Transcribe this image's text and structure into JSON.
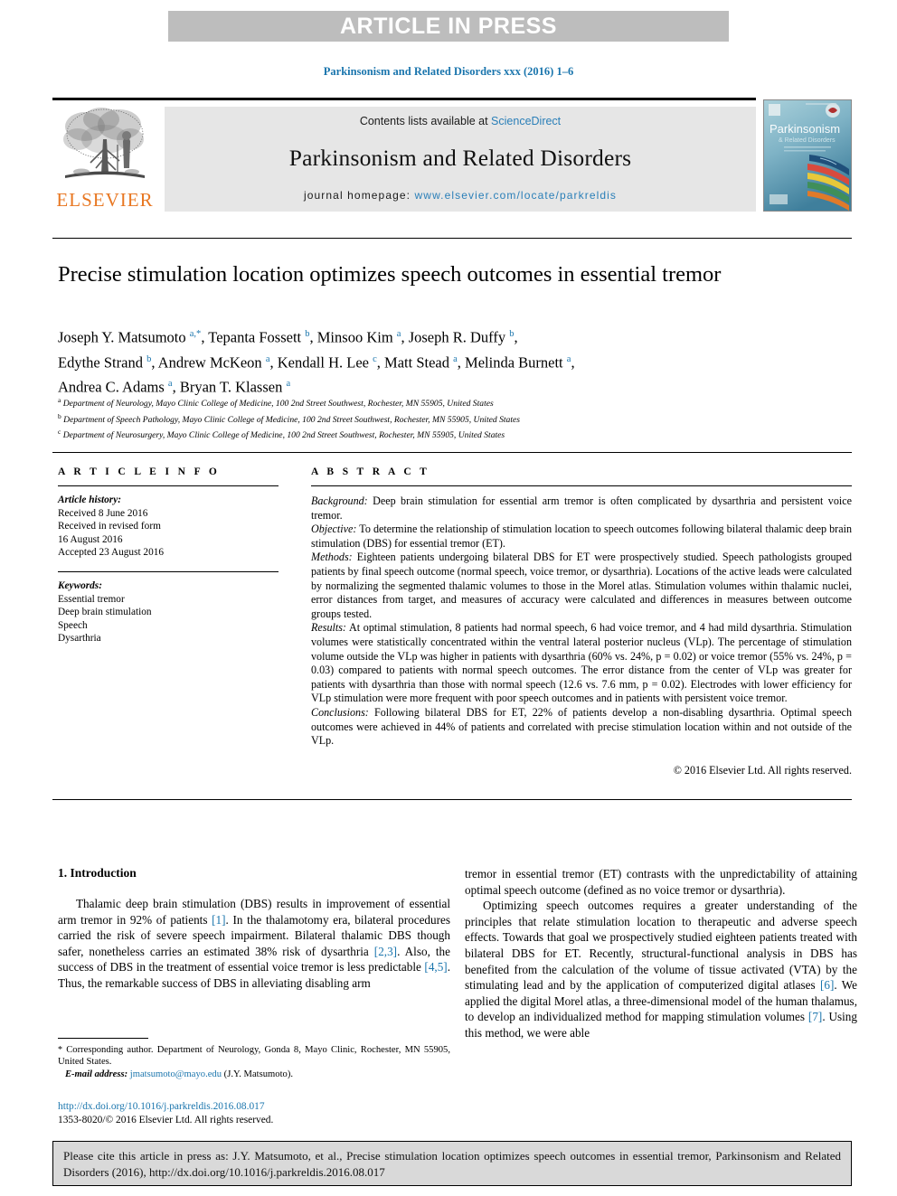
{
  "banner": {
    "text": "ARTICLE IN PRESS"
  },
  "journal_ref": "Parkinsonism and Related Disorders xxx (2016) 1–6",
  "masthead": {
    "contents_prefix": "Contents lists available at ",
    "sciencedirect": "ScienceDirect",
    "journal_title": "Parkinsonism and Related Disorders",
    "homepage_label": "journal homepage: ",
    "homepage_url": "www.elsevier.com/locate/parkreldis",
    "publisher_wordmark": "ELSEVIER",
    "cover_title": "Parkinsonism",
    "cover_subtitle": "& Related Disorders"
  },
  "article": {
    "title": "Precise stimulation location optimizes speech outcomes in essential tremor",
    "authors_line1": "Joseph Y. Matsumoto",
    "authors": "Joseph Y. Matsumoto a,*, Tepanta Fossett b, Minsoo Kim a, Joseph R. Duffy b, Edythe Strand b, Andrew McKeon a, Kendall H. Lee c, Matt Stead a, Melinda Burnett a, Andrea C. Adams a, Bryan T. Klassen a",
    "affiliations": [
      {
        "marker": "a",
        "text": "Department of Neurology, Mayo Clinic College of Medicine, 100 2nd Street Southwest, Rochester, MN 55905, United States"
      },
      {
        "marker": "b",
        "text": "Department of Speech Pathology, Mayo Clinic College of Medicine, 100 2nd Street Southwest, Rochester, MN 55905, United States"
      },
      {
        "marker": "c",
        "text": "Department of Neurosurgery, Mayo Clinic College of Medicine, 100 2nd Street Southwest, Rochester, MN 55905, United States"
      }
    ]
  },
  "article_info": {
    "heading": "A R T I C L E   I N F O",
    "history_label": "Article history:",
    "history": [
      "Received 8 June 2016",
      "Received in revised form",
      "16 August 2016",
      "Accepted 23 August 2016"
    ],
    "keywords_label": "Keywords:",
    "keywords": [
      "Essential tremor",
      "Deep brain stimulation",
      "Speech",
      "Dysarthria"
    ]
  },
  "abstract": {
    "heading": "A B S T R A C T",
    "sections": [
      {
        "label": "Background:",
        "text": " Deep brain stimulation for essential arm tremor is often complicated by dysarthria and persistent voice tremor."
      },
      {
        "label": "Objective:",
        "text": " To determine the relationship of stimulation location to speech outcomes following bilateral thalamic deep brain stimulation (DBS) for essential tremor (ET)."
      },
      {
        "label": "Methods:",
        "text": " Eighteen patients undergoing bilateral DBS for ET were prospectively studied. Speech pathologists grouped patients by final speech outcome (normal speech, voice tremor, or dysarthria). Locations of the active leads were calculated by normalizing the segmented thalamic volumes to those in the Morel atlas. Stimulation volumes within thalamic nuclei, error distances from target, and measures of accuracy were calculated and differences in measures between outcome groups tested."
      },
      {
        "label": "Results:",
        "text": " At optimal stimulation, 8 patients had normal speech, 6 had voice tremor, and 4 had mild dysarthria. Stimulation volumes were statistically concentrated within the ventral lateral posterior nucleus (VLp). The percentage of stimulation volume outside the VLp was higher in patients with dysarthria (60% vs. 24%, p = 0.02) or voice tremor (55% vs. 24%, p = 0.03) compared to patients with normal speech outcomes. The error distance from the center of VLp was greater for patients with dysarthria than those with normal speech (12.6 vs. 7.6 mm, p = 0.02). Electrodes with lower efficiency for VLp stimulation were more frequent with poor speech outcomes and in patients with persistent voice tremor."
      },
      {
        "label": "Conclusions:",
        "text": " Following bilateral DBS for ET, 22% of patients develop a non-disabling dysarthria. Optimal speech outcomes were achieved in 44% of patients and correlated with precise stimulation location within and not outside of the VLp."
      }
    ],
    "copyright": "© 2016 Elsevier Ltd. All rights reserved."
  },
  "introduction": {
    "heading": "1. Introduction",
    "left_para_1_a": "Thalamic deep brain stimulation (DBS) results in improvement of essential arm tremor in 92% of patients ",
    "left_cite_1": "[1]",
    "left_para_1_b": ". In the thalamotomy era, bilateral procedures carried the risk of severe speech impairment. Bilateral thalamic DBS though safer, nonetheless carries an estimated 38% risk of dysarthria ",
    "left_cite_2": "[2,3]",
    "left_para_1_c": ". Also, the success of DBS in the treatment of essential voice tremor is less predictable ",
    "left_cite_3": "[4,5]",
    "left_para_1_d": ". Thus, the remarkable success of DBS in alleviating disabling arm",
    "right_para_1": "tremor in essential tremor (ET) contrasts with the unpredictability of attaining optimal speech outcome (defined as no voice tremor or dysarthria).",
    "right_para_2_a": "Optimizing speech outcomes requires a greater understanding of the principles that relate stimulation location to therapeutic and adverse speech effects. Towards that goal we prospectively studied eighteen patients treated with bilateral DBS for ET. Recently, structural-functional analysis in DBS has benefited from the calculation of the volume of tissue activated (VTA) by the stimulating lead and by the application of computerized digital atlases ",
    "right_cite_1": "[6]",
    "right_para_2_b": ". We applied the digital Morel atlas, a three-dimensional model of the human thalamus, to develop an individualized method for mapping stimulation volumes ",
    "right_cite_2": "[7]",
    "right_para_2_c": ". Using this method, we were able"
  },
  "footnote": {
    "star": "*",
    "corresponding": " Corresponding author. Department of Neurology, Gonda 8, Mayo Clinic, Rochester, MN 55905, United States.",
    "email_label": "E-mail address:",
    "email": "jmatsumoto@mayo.edu",
    "email_suffix": " (J.Y. Matsumoto)."
  },
  "doi_block": {
    "doi_url": "http://dx.doi.org/10.1016/j.parkreldis.2016.08.017",
    "issn_line": "1353-8020/© 2016 Elsevier Ltd. All rights reserved."
  },
  "cite_box": {
    "text": "Please cite this article in press as: J.Y. Matsumoto, et al., Precise stimulation location optimizes speech outcomes in essential tremor, Parkinsonism and Related Disorders (2016), http://dx.doi.org/10.1016/j.parkreldis.2016.08.017"
  },
  "colors": {
    "link_blue": "#1a75ad",
    "banner_gray": "#bdbdbd",
    "box_gray": "#e6e6e6",
    "elsevier_orange": "#e87722"
  }
}
